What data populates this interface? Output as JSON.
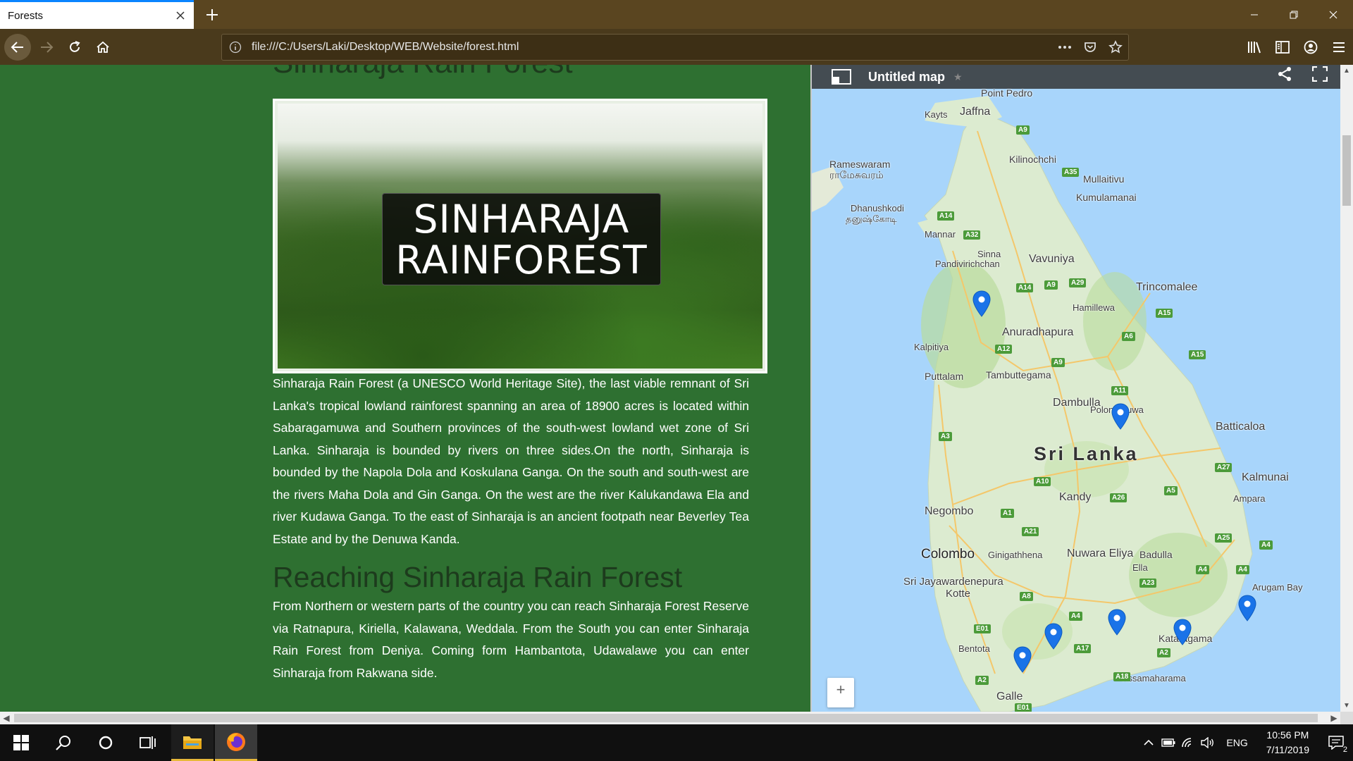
{
  "browser": {
    "tab_title": "Forests",
    "url": "file:///C:/Users/Laki/Desktop/WEB/Website/forest.html",
    "colors": {
      "tabbar": "#5a4520",
      "navbar": "#4a3a1c",
      "tab_accent": "#0a84ff"
    }
  },
  "page": {
    "cut_heading": "Sinharaja Rain Forest",
    "banner_line_1": "SINHARAJA",
    "banner_line_2": "RAINFOREST",
    "paragraph_1": "Sinharaja Rain Forest (a UNESCO World Heritage Site), the last viable remnant of Sri Lanka's tropical lowland rainforest spanning an area of 18900 acres is located within Sabaragamuwa and Southern provinces of the south-west lowland wet zone of Sri Lanka. Sinharaja is bounded by rivers on three sides.On the north, Sinharaja is bounded by the Napola Dola and Koskulana Ganga. On the south and south-west are the rivers Maha Dola and Gin Ganga. On the west are the river Kalukandawa Ela and river Kudawa Ganga. To the east of Sinharaja is an ancient footpath near Beverley Tea Estate and by the Denuwa Kanda.",
    "reaching_heading": "Reaching Sinharaja Rain Forest",
    "paragraph_2": "From Northern or western parts of the country you can reach Sinharaja Forest Reserve via Ratnapura, Kiriella, Kalawana, Weddala. From the South you can enter Sinharaja Rain Forest from Deniya. Coming form Hambantota, Udawalawe you can enter Sinharaja from Rakwana side.",
    "colors": {
      "background": "#2e7031",
      "heading": "#1d3b1d",
      "text": "#ffffff"
    }
  },
  "map": {
    "title": "Untitled map",
    "zoom_in": "+",
    "country": "Sri Lanka",
    "places": {
      "point_pedro": "Point Pedro",
      "kayts": "Kayts",
      "jaffna": "Jaffna",
      "rameswaram": "Rameswaram",
      "rameswaram_ta": "ராமேசுவரம்",
      "kilinochchi": "Kilinochchi",
      "mullaitivu": "Mullaitivu",
      "kumulamanai": "Kumulamanai",
      "dhanushkodi": "Dhanushkodi",
      "dhanushkodi_ta": "தனுஷ்கோடி",
      "mannar": "Mannar",
      "sinna": "Sinna",
      "pandivirichchan": "Pandivirichchan",
      "vavuniya": "Vavuniya",
      "trincomalee": "Trincomalee",
      "hamillewa": "Hamillewa",
      "anuradhapura": "Anuradhapura",
      "kalpitiya": "Kalpitiya",
      "puttalam": "Puttalam",
      "tambuttegama": "Tambuttegama",
      "dambulla": "Dambulla",
      "polonnaruwa": "Polonnaruwa",
      "batticaloa": "Batticaloa",
      "kalmunai": "Kalmunai",
      "ampara": "Ampara",
      "kandy": "Kandy",
      "negombo": "Negombo",
      "colombo": "Colombo",
      "ginigathhena": "Ginigathhena",
      "nuwara_eliya": "Nuwara Eliya",
      "badulla": "Badulla",
      "ella": "Ella",
      "sri_jayawardenepura": "Sri Jayawardenepura",
      "kotte": "Kotte",
      "arugam_bay": "Arugam Bay",
      "kataragama": "Kataragama",
      "bentota": "Bentota",
      "tissamaharama": "Tissamaharama",
      "galle": "Galle"
    },
    "roads": [
      "A9",
      "A35",
      "A14",
      "A32",
      "A29",
      "A14",
      "A9",
      "A15",
      "A6",
      "A12",
      "A9",
      "A15",
      "A11",
      "A3",
      "A27",
      "A10",
      "A5",
      "A26",
      "A1",
      "A21",
      "A25",
      "A4",
      "A4",
      "A4",
      "A23",
      "A8",
      "A4",
      "E01",
      "A17",
      "A2",
      "A18",
      "A2",
      "E01"
    ],
    "pin_color": "#1a73e8",
    "colors": {
      "water": "#a8d5fb",
      "land": "#dcebd0",
      "park": "#b9dc9c"
    }
  },
  "taskbar": {
    "language": "ENG",
    "time": "10:56 PM",
    "date": "7/11/2019",
    "notification_count": "2"
  }
}
